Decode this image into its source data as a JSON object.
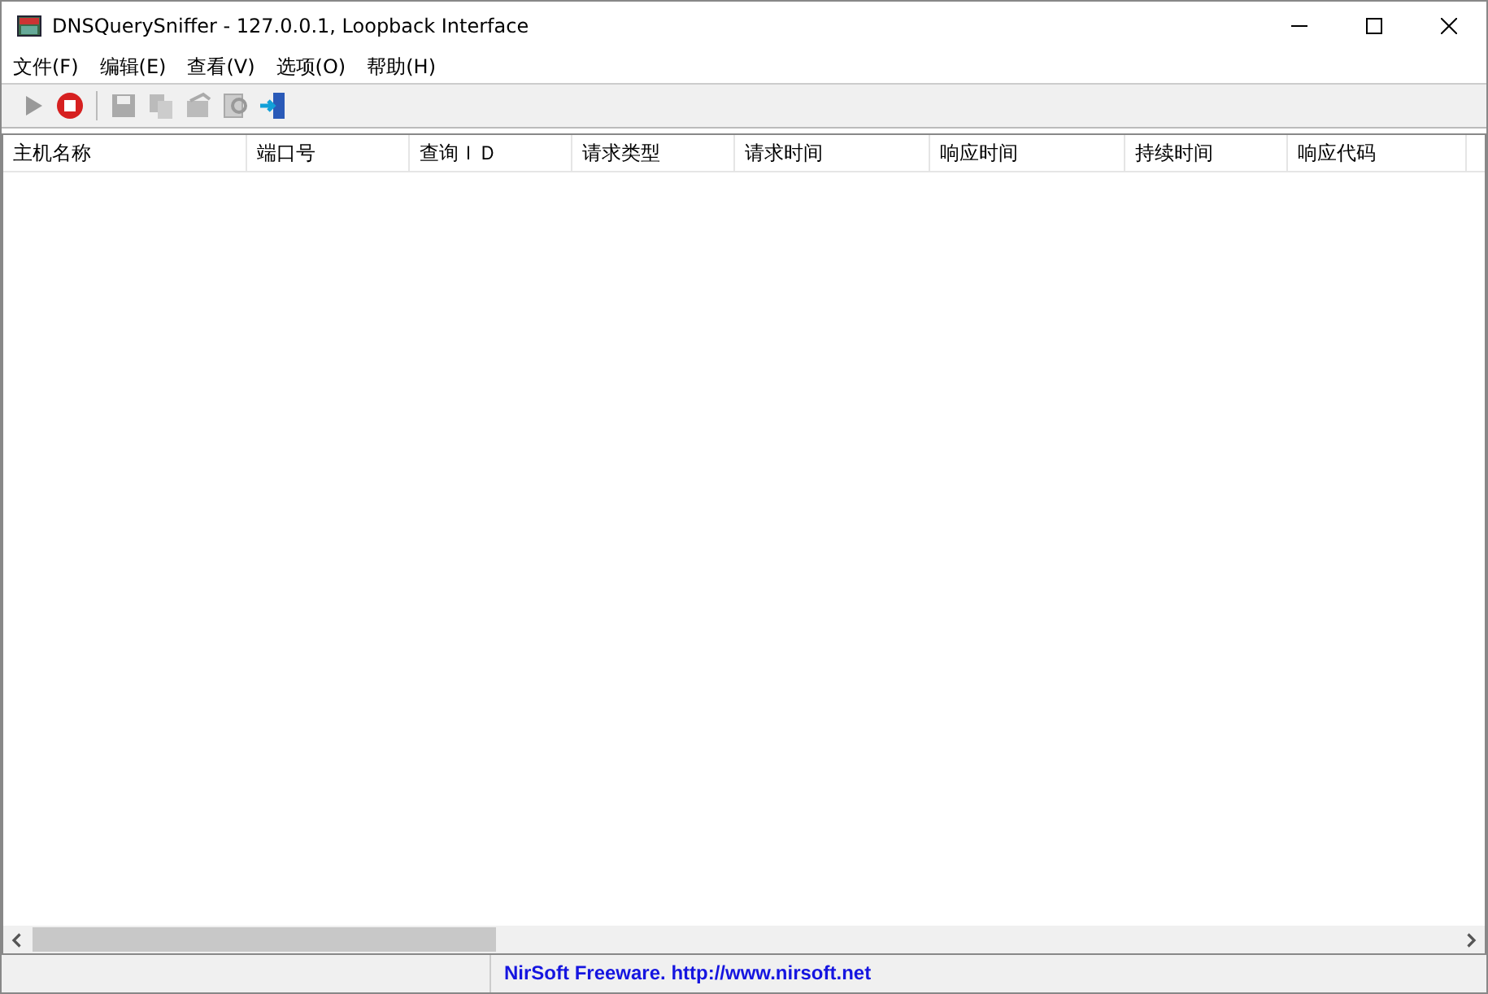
{
  "window": {
    "title": "DNSQuerySniffer  -  127.0.0.1, Loopback Interface"
  },
  "menu": [
    "文件(F)",
    "编辑(E)",
    "查看(V)",
    "选项(O)",
    "帮助(H)"
  ],
  "toolbar": [
    {
      "kind": "play",
      "disabled": true
    },
    {
      "kind": "stop",
      "disabled": false
    },
    {
      "kind": "save",
      "disabled": true
    },
    {
      "kind": "copy",
      "disabled": true
    },
    {
      "kind": "properties",
      "disabled": true
    },
    {
      "kind": "find",
      "disabled": true
    },
    {
      "kind": "exit",
      "disabled": false
    }
  ],
  "table": {
    "columns": [
      "主机名称",
      "端口号",
      "查询ＩＤ",
      "请求类型",
      "请求时间",
      "响应时间",
      "持续时间",
      "响应代码"
    ]
  },
  "status_bar": {
    "text": "NirSoft Freeware.  http://www.nirsoft.net"
  }
}
